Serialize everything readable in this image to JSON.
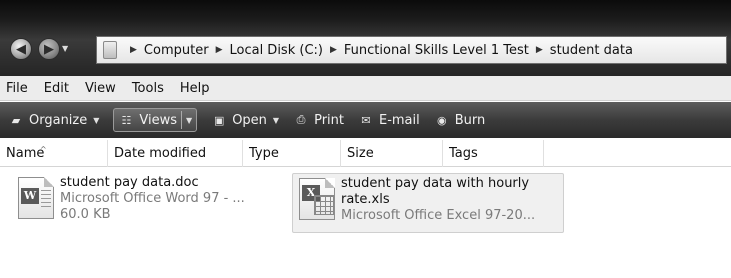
{
  "address_bar": {
    "breadcrumbs": [
      "Computer",
      "Local Disk (C:)",
      "Functional Skills Level 1 Test",
      "student data"
    ]
  },
  "menu": [
    "File",
    "Edit",
    "View",
    "Tools",
    "Help"
  ],
  "toolbar": {
    "organize": "Organize",
    "views": "Views",
    "open": "Open",
    "print": "Print",
    "email": "E-mail",
    "burn": "Burn"
  },
  "columns": [
    "Name",
    "Date modified",
    "Type",
    "Size",
    "Tags"
  ],
  "files": [
    {
      "name": "student pay data.doc",
      "type": "Microsoft Office Word 97 - ...",
      "size": "60.0 KB",
      "icon": "word-document-icon"
    },
    {
      "name_line1": "student pay data with hourly",
      "name_line2": "rate.xls",
      "type": "Microsoft Office Excel 97-20...",
      "icon": "excel-spreadsheet-icon",
      "selected": true
    }
  ]
}
